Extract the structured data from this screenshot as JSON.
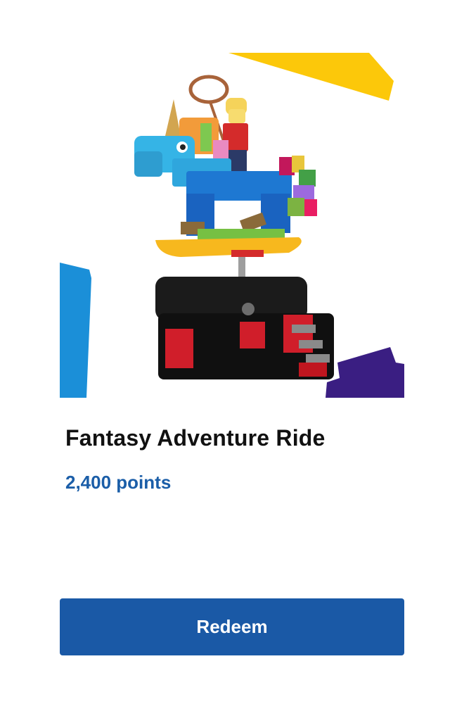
{
  "product": {
    "title": "Fantasy Adventure Ride",
    "points": "2,400 points",
    "image_alt": "Fantasy Adventure Ride LEGO set"
  },
  "actions": {
    "redeem_label": "Redeem"
  },
  "colors": {
    "points_text": "#1b5ea8",
    "button_bg": "#1a59a6",
    "button_text": "#ffffff",
    "title_text": "#111111",
    "accent_yellow": "#fcc80a",
    "accent_blue": "#1b8fd8",
    "accent_purple": "#3a1e82"
  }
}
